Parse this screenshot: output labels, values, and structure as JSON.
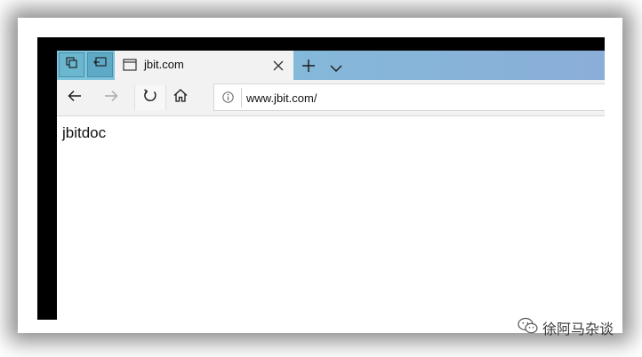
{
  "tab": {
    "title": "jbit.com"
  },
  "address": {
    "url": "www.jbit.com/"
  },
  "page": {
    "body_text": "jbitdoc"
  },
  "watermark": {
    "text": "徐阿马杂谈"
  },
  "icons": {
    "tab_actions_1": "tab-set-aside-icon",
    "tab_actions_2": "tabs-aside-icon",
    "page": "page-icon",
    "close": "close-icon",
    "new_tab": "plus-icon",
    "tab_preview": "chevron-down-icon",
    "back": "arrow-left-icon",
    "forward": "arrow-right-icon",
    "refresh": "refresh-icon",
    "home": "home-icon",
    "info": "info-icon",
    "wechat": "wechat-icon"
  },
  "colors": {
    "tabstrip_start": "#7cc4dc",
    "tabstrip_end": "#8aaed8",
    "frame": "#000000",
    "chrome": "#f2f2f2"
  }
}
